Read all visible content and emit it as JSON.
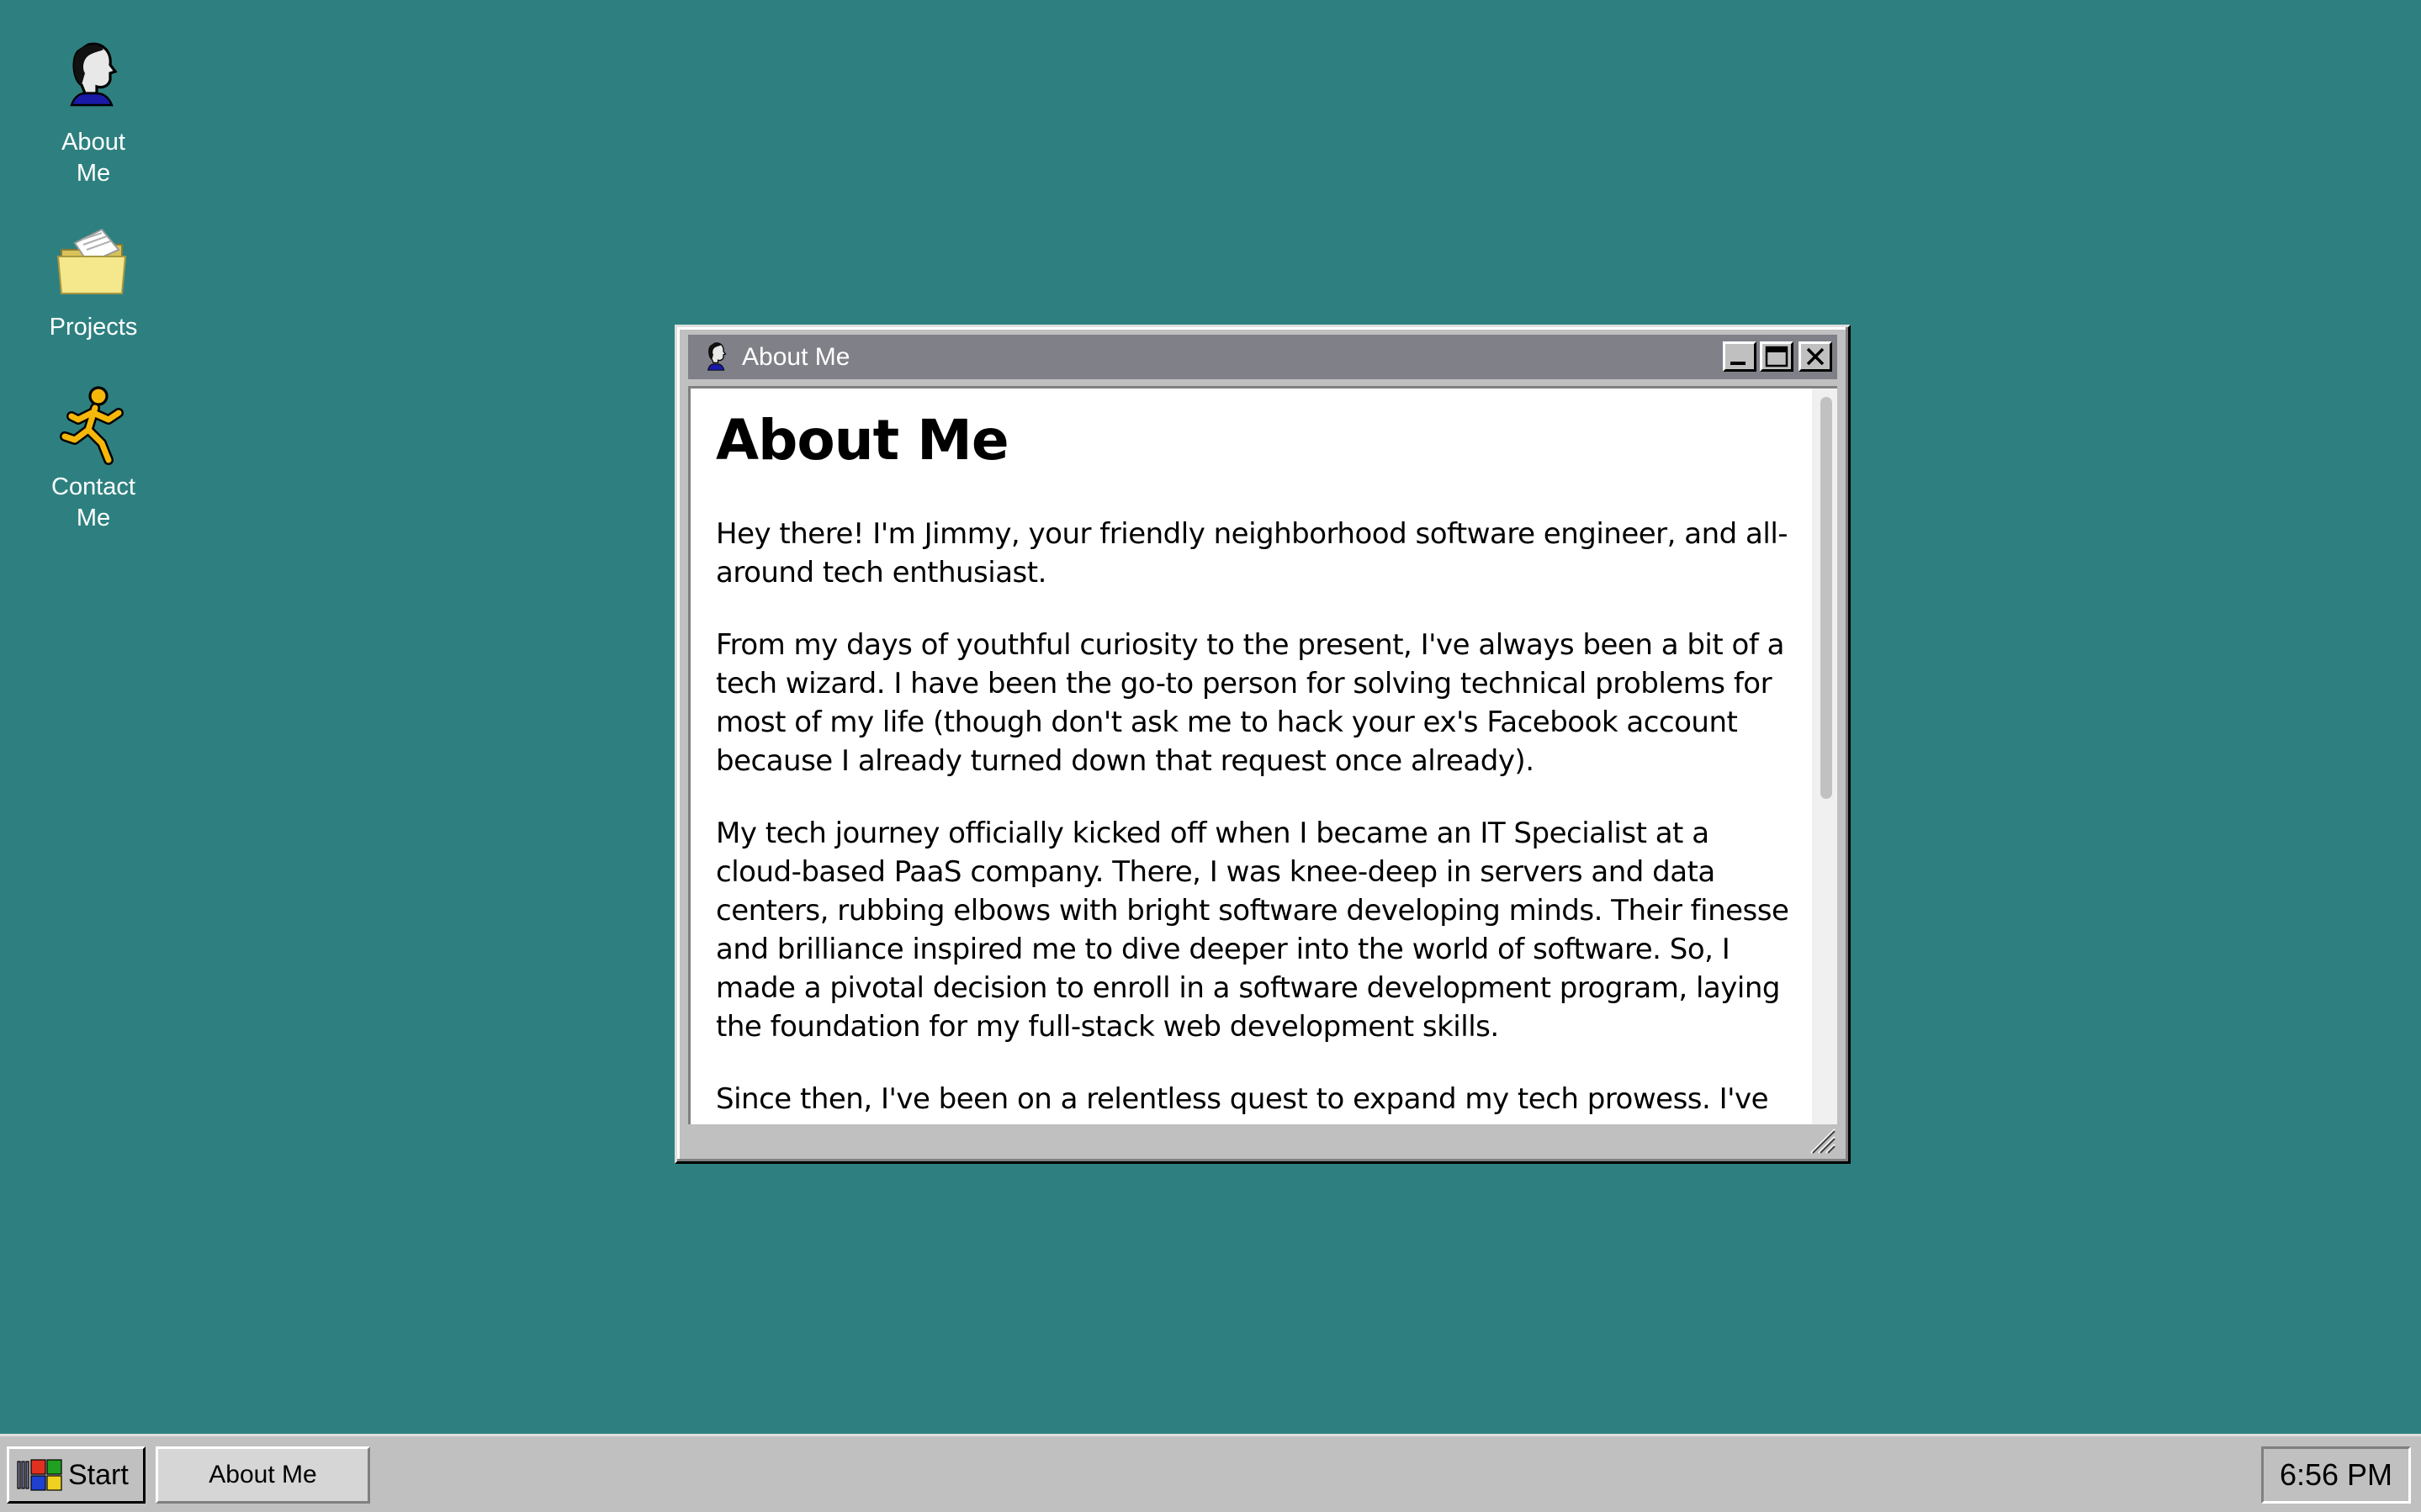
{
  "desktop": {
    "icons": [
      {
        "label": "About\nMe",
        "icon": "person-icon"
      },
      {
        "label": "Projects",
        "icon": "folder-icon"
      },
      {
        "label": "Contact\nMe",
        "icon": "runner-icon"
      }
    ]
  },
  "window": {
    "title": "About Me",
    "heading": "About Me",
    "paragraphs": [
      "Hey there! I'm Jimmy, your friendly neighborhood software engineer, and all-around tech enthusiast.",
      "From my days of youthful curiosity to the present, I've always been a bit of a tech wizard. I have been the go-to person for solving technical problems for most of my life (though don't ask me to hack your ex's Facebook account because I already turned down that request once already).",
      "My tech journey officially kicked off when I became an IT Specialist at a cloud-based PaaS company. There, I was knee-deep in servers and data centers, rubbing elbows with bright software developing minds. Their finesse and brilliance inspired me to dive deeper into the world of software. So, I made a pivotal decision to enroll in a software development program, laying the foundation for my full-stack web development skills.",
      "Since then, I've been on a relentless quest to expand my tech prowess. I've built"
    ],
    "buttons": {
      "minimize": "minimize-icon",
      "maximize": "maximize-icon",
      "close": "close-icon"
    }
  },
  "taskbar": {
    "start_label": "Start",
    "task_item": "About Me",
    "clock": "6:56 PM"
  },
  "colors": {
    "desktop": "#2e8080",
    "titlebar": "#808088",
    "chrome": "#c0c0c0"
  }
}
